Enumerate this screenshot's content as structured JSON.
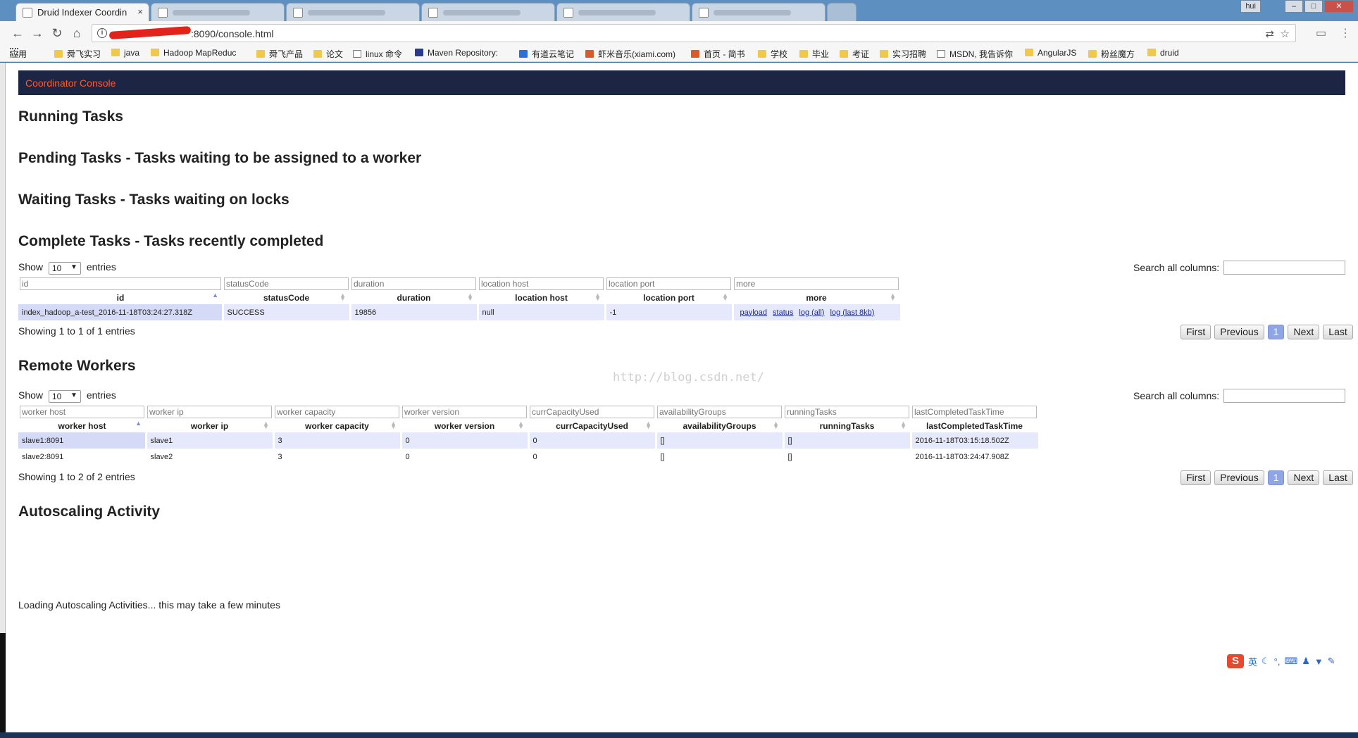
{
  "browser": {
    "active_tab_title": "Druid Indexer Coordin",
    "tab_close_glyph": "×",
    "profile_name": "hui",
    "url": ":8090/console.html",
    "icons": [
      "back-arrow-icon",
      "forward-arrow-icon",
      "reload-icon",
      "home-icon",
      "info-icon",
      "translate-icon",
      "star-icon",
      "menu-icon"
    ]
  },
  "bookmarks": [
    {
      "label": "应用",
      "icon": "grid"
    },
    {
      "label": "舜飞实习",
      "icon": "folder"
    },
    {
      "label": "java",
      "icon": "folder"
    },
    {
      "label": "Hadoop MapReduc",
      "icon": "folder"
    },
    {
      "label": "舜飞产品",
      "icon": "folder"
    },
    {
      "label": "论文",
      "icon": "folder"
    },
    {
      "label": "linux 命令",
      "icon": "page"
    },
    {
      "label": "Maven Repository:",
      "icon": "navy"
    },
    {
      "label": "有道云笔记",
      "icon": "blue"
    },
    {
      "label": "虾米音乐(xiami.com)",
      "icon": "red"
    },
    {
      "label": "首页 - 简书",
      "icon": "red"
    },
    {
      "label": "学校",
      "icon": "folder"
    },
    {
      "label": "毕业",
      "icon": "folder"
    },
    {
      "label": "考证",
      "icon": "folder"
    },
    {
      "label": "实习招聘",
      "icon": "folder"
    },
    {
      "label": "MSDN, 我告诉你",
      "icon": "page"
    },
    {
      "label": "AngularJS",
      "icon": "folder"
    },
    {
      "label": "粉丝魔方",
      "icon": "folder"
    },
    {
      "label": "druid",
      "icon": "folder"
    }
  ],
  "header": {
    "title": "Coordinator Console"
  },
  "sections": {
    "running": "Running Tasks",
    "pending": "Pending Tasks - Tasks waiting to be assigned to a worker",
    "waiting": "Waiting Tasks - Tasks waiting on locks",
    "complete": "Complete Tasks - Tasks recently completed",
    "workers": "Remote Workers",
    "autoscaling": "Autoscaling Activity"
  },
  "common": {
    "show": "Show",
    "entries": "entries",
    "page_length": "10",
    "search_label": "Search all columns:",
    "pager": {
      "first": "First",
      "previous": "Previous",
      "current": "1",
      "next": "Next",
      "last": "Last"
    }
  },
  "complete_tasks": {
    "columns": [
      "id",
      "statusCode",
      "duration",
      "location host",
      "location port",
      "more"
    ],
    "rows": [
      {
        "id": "index_hadoop_a-test_2016-11-18T03:24:27.318Z",
        "statusCode": "SUCCESS",
        "duration": "19856",
        "location_host": "null",
        "location_port": "-1",
        "links": [
          "payload",
          "status",
          "log (all)",
          "log (last 8kb)"
        ]
      }
    ],
    "info": "Showing 1 to 1 of 1 entries"
  },
  "workers": {
    "columns": [
      "worker host",
      "worker ip",
      "worker capacity",
      "worker version",
      "currCapacityUsed",
      "availabilityGroups",
      "runningTasks",
      "lastCompletedTaskTime"
    ],
    "rows": [
      [
        "slave1:8091",
        "slave1",
        "3",
        "0",
        "0",
        "[]",
        "[]",
        "2016-11-18T03:15:18.502Z"
      ],
      [
        "slave2:8091",
        "slave2",
        "3",
        "0",
        "0",
        "[]",
        "[]",
        "2016-11-18T03:24:47.908Z"
      ]
    ],
    "info": "Showing 1 to 2 of 2 entries"
  },
  "autoscaling": {
    "loading": "Loading Autoscaling Activities... this may take a few minutes"
  },
  "watermark": "http://blog.csdn.net/",
  "ime": {
    "logo": "S",
    "mode": "英"
  }
}
